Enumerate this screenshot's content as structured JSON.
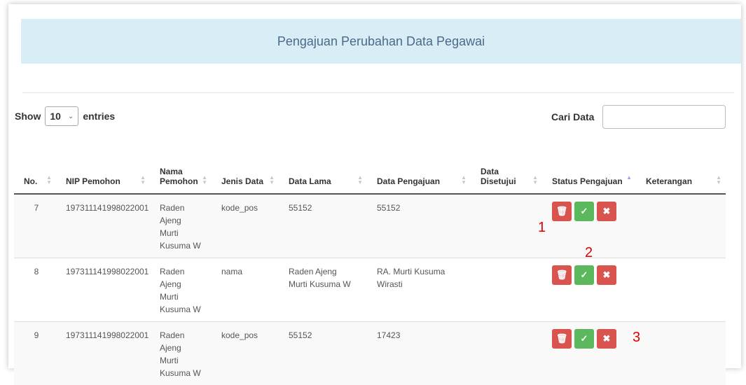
{
  "page": {
    "title": "Pengajuan Perubahan Data Pegawai"
  },
  "controls": {
    "show_label": "Show",
    "entries_value": "10",
    "entries_label": "entries",
    "search_label": "Cari Data",
    "search_value": ""
  },
  "table": {
    "headers": [
      "No.",
      "NIP Pemohon",
      "Nama Pemohon",
      "Jenis Data",
      "Data Lama",
      "Data Pengajuan",
      "Data Disetujui",
      "Status Pengajuan",
      "Keterangan"
    ],
    "rows": [
      {
        "no": "7",
        "nip": "197311141998022001",
        "nama": "Raden Ajeng Murti Kusuma W",
        "jenis": "kode_pos",
        "lama": "55152",
        "pengajuan": "55152",
        "disetujui": "",
        "keterangan": ""
      },
      {
        "no": "8",
        "nip": "197311141998022001",
        "nama": "Raden Ajeng Murti Kusuma W",
        "jenis": "nama",
        "lama": "Raden Ajeng Murti Kusuma W",
        "pengajuan": "RA. Murti Kusuma Wirasti",
        "disetujui": "",
        "keterangan": ""
      },
      {
        "no": "9",
        "nip": "197311141998022001",
        "nama": "Raden Ajeng Murti Kusuma W",
        "jenis": "kode_pos",
        "lama": "55152",
        "pengajuan": "17423",
        "disetujui": "",
        "keterangan": ""
      }
    ]
  },
  "action_icons": {
    "delete": "trash-icon",
    "approve": "check-square-icon",
    "reject": "close-icon"
  },
  "annotations": [
    "1",
    "2",
    "3"
  ],
  "colors": {
    "header_band": "#d9edf7",
    "red_button": "#d9534f",
    "green_button": "#5cb85c",
    "annotation": "#e00000"
  }
}
